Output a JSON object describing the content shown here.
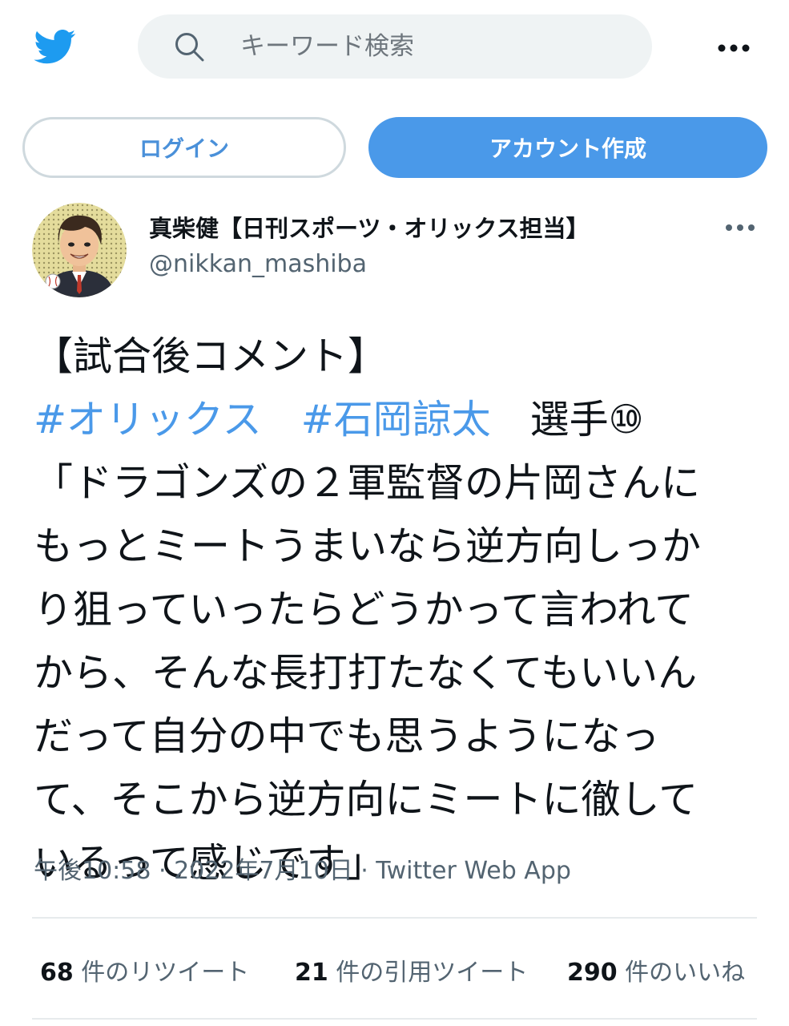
{
  "header": {
    "logo_icon": "twitter-bird-icon",
    "search_placeholder": "キーワード検索",
    "more_icon": "more-horizontal-icon"
  },
  "auth": {
    "login_label": "ログイン",
    "signup_label": "アカウント作成"
  },
  "tweet": {
    "author_name": "真柴健【日刊スポーツ・オリックス担当】",
    "author_handle": "@nikkan_mashiba",
    "lines": [
      {
        "pre": "【試合後コメント】"
      },
      {
        "hashtag1": "#オリックス",
        "gap": "　",
        "hashtag2": "#石岡諒太",
        "post": "　選手⑩"
      },
      {
        "pre": "「ドラゴンズの２軍監督の片岡さんに"
      },
      {
        "pre": "もっとミートうまいなら逆方向しっか"
      },
      {
        "pre": "り狙っていったらどうかって言われて"
      },
      {
        "pre": "から、そんな長打打たなくてもいいん"
      },
      {
        "pre": "だって自分の中でも思うようになっ"
      },
      {
        "pre": "て、そこから逆方向にミートに徹して"
      },
      {
        "pre": "いるって感じです」"
      }
    ],
    "meta": "午後10:58 · 2022年7月10日 · Twitter Web App",
    "stats": {
      "retweets_count": "68",
      "retweets_label": "件のリツイート",
      "quotes_count": "21",
      "quotes_label": "件の引用ツイート",
      "likes_count": "290",
      "likes_label": "件のいいね"
    }
  },
  "colors": {
    "accent": "#4a99e9",
    "secondary_text": "#536471",
    "search_bg": "#eff3f4"
  }
}
